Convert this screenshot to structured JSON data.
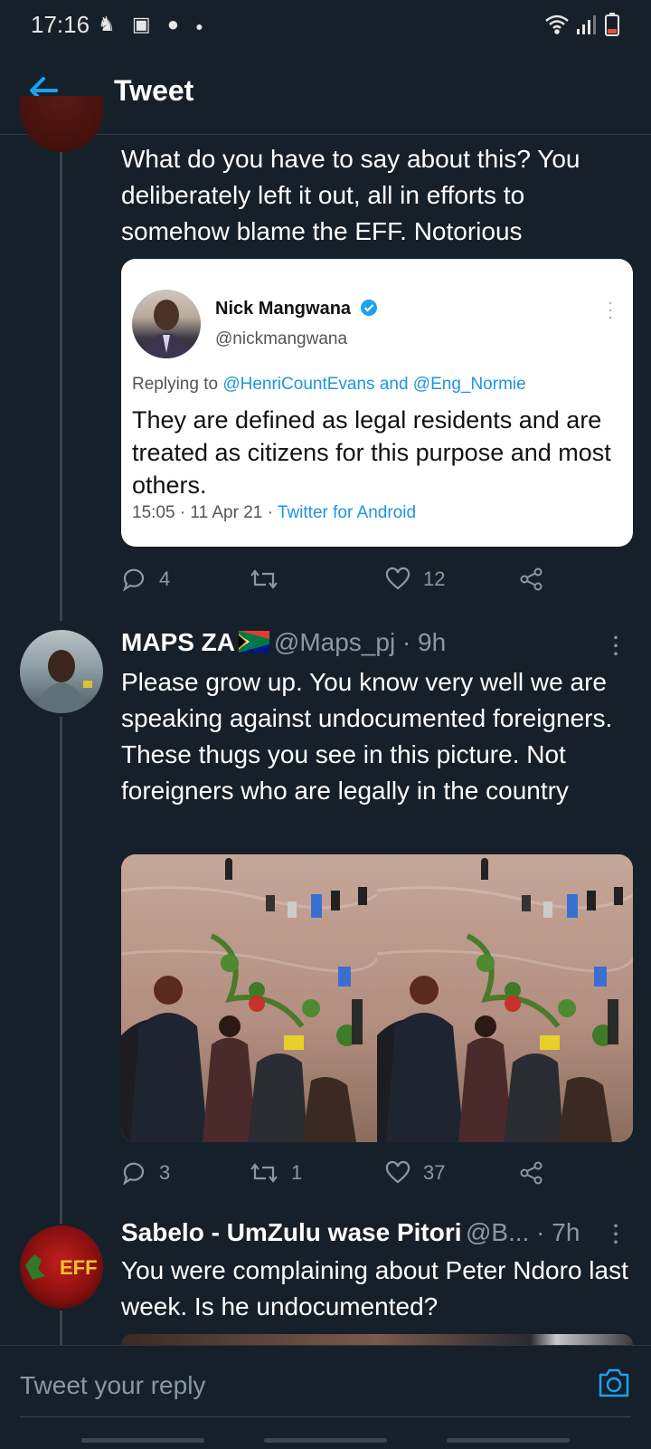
{
  "status_bar": {
    "time": "17:16",
    "left_icons": [
      "person-walking-icon",
      "image-icon",
      "facebook-icon",
      "dot-icon"
    ],
    "right_icons": [
      "wifi-icon",
      "signal-icon",
      "battery-icon"
    ]
  },
  "header": {
    "title": "Tweet"
  },
  "tweet1": {
    "text": "What do you have to say about this? You deliberately left it out, all in efforts to somehow blame the EFF. Notorious",
    "quote": {
      "name": "Nick Mangwana",
      "handle": "@nickmangwana",
      "replying_prefix": "Replying to ",
      "replying_users": "@HenriCountEvans and @Eng_Normie",
      "text": "They are defined as legal residents and are treated as citizens for this purpose and most others.",
      "time": "15:05 · 11 Apr 21 · ",
      "source": "Twitter for Android"
    },
    "actions": {
      "replies": "4",
      "retweets": "",
      "likes": "12"
    }
  },
  "tweet2": {
    "name": "MAPS ZA",
    "handle": "@Maps_pj · 9h",
    "text": "Please grow up. You know very well we are speaking against undocumented foreigners. These thugs you see in this picture. Not foreigners who are legally in the country",
    "actions": {
      "replies": "3",
      "retweets": "1",
      "likes": "37"
    }
  },
  "tweet3": {
    "name": "Sabelo - UmZulu wase Pitori",
    "handle": "@B... · 7h",
    "avatar_text": "EFF",
    "text": "You were complaining about Peter Ndoro last week. Is he undocumented?"
  },
  "composer": {
    "placeholder": "Tweet your reply"
  },
  "colors": {
    "background": "#15202b",
    "accent": "#1da1f2",
    "muted": "#8899a6"
  }
}
